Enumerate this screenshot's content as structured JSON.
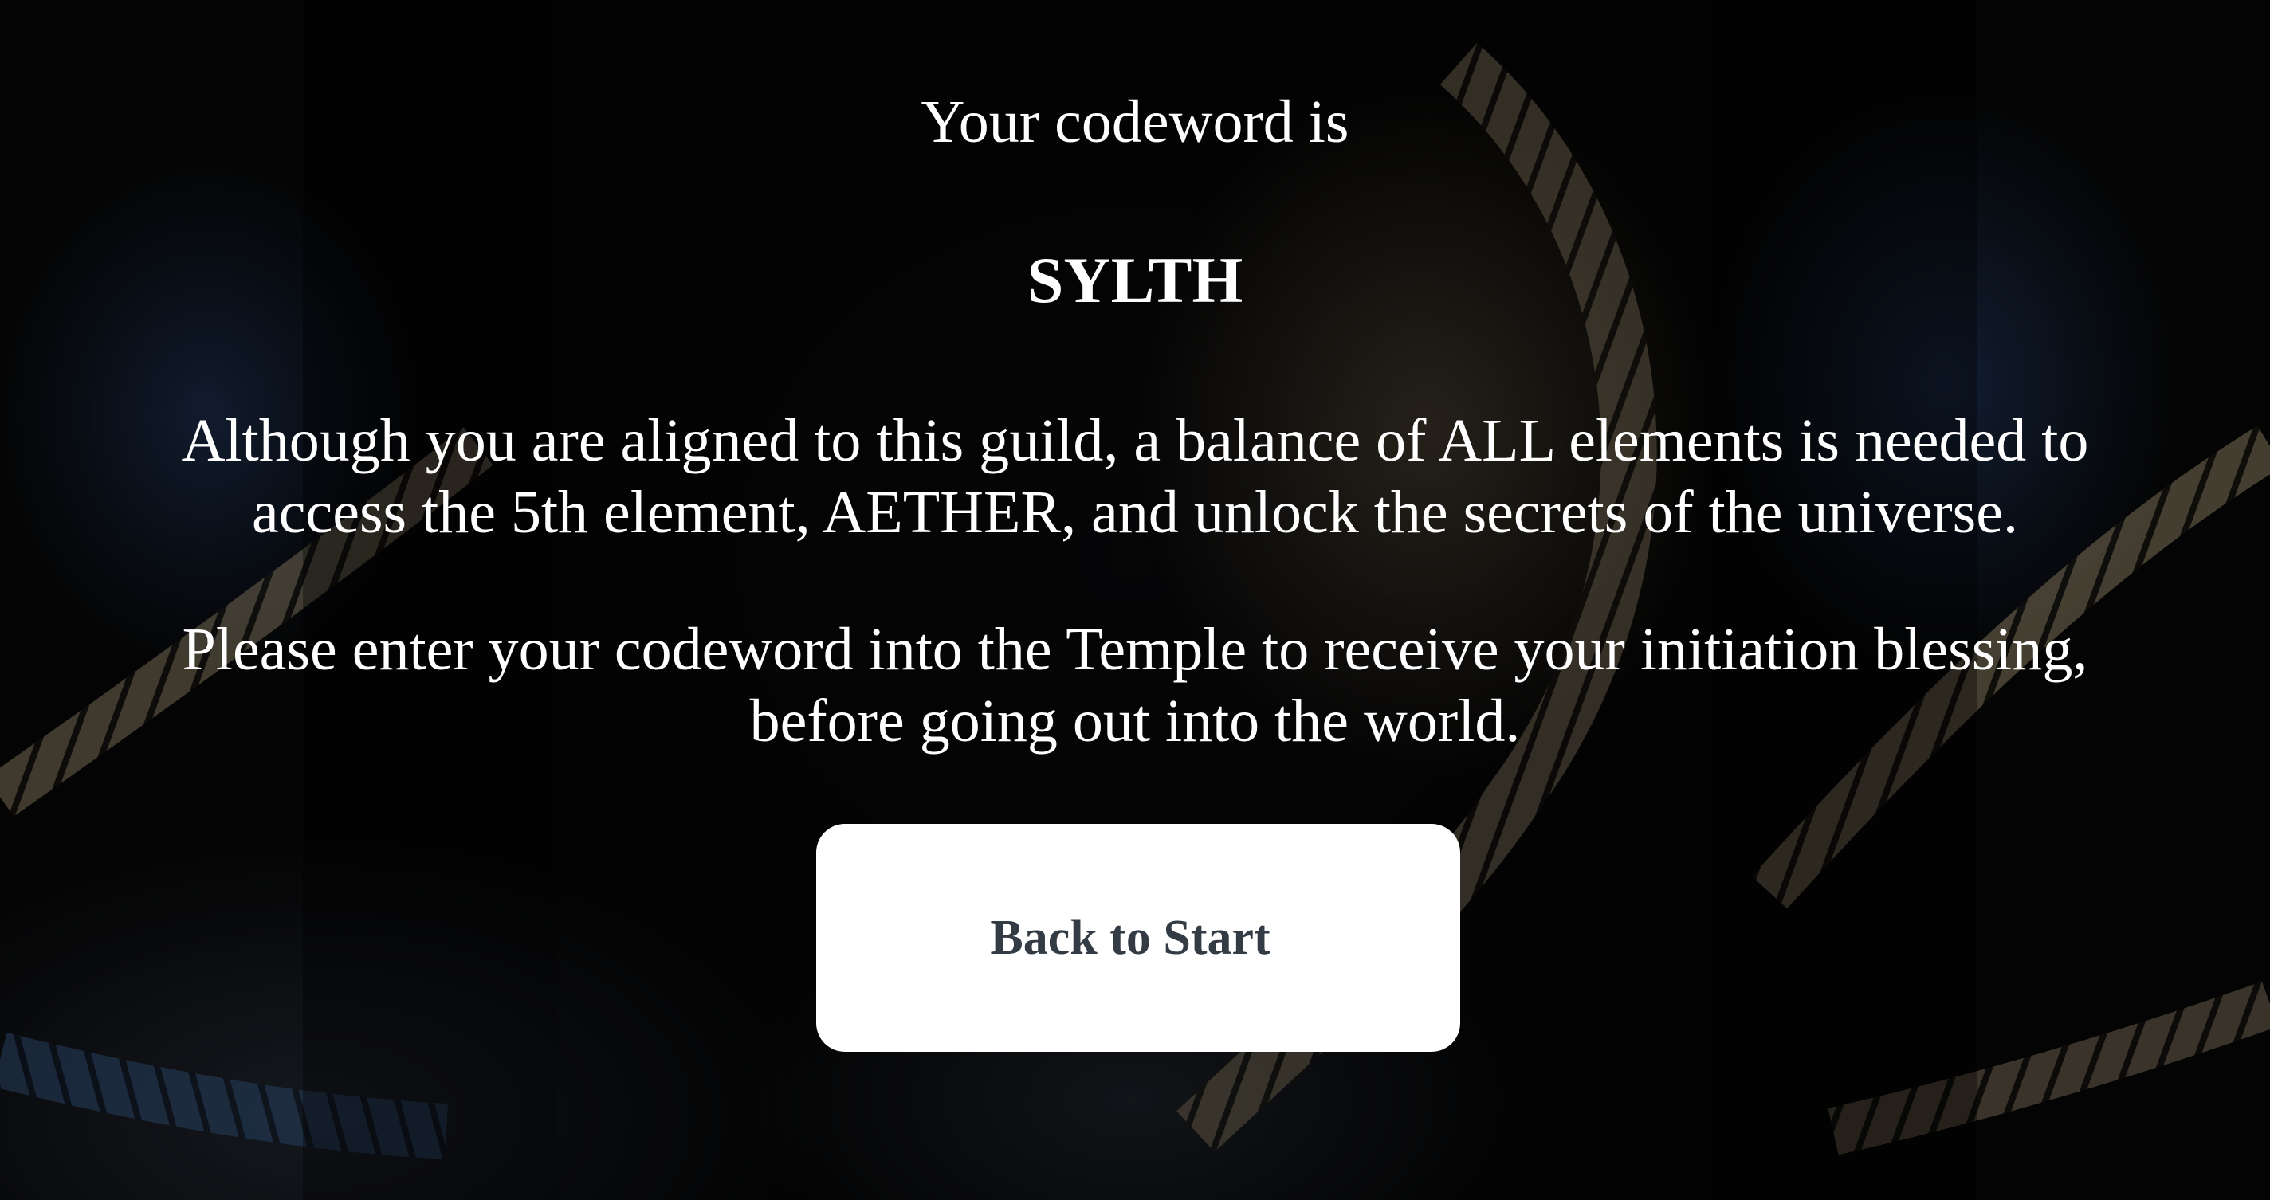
{
  "message": {
    "intro": "Your codeword is",
    "codeword": "SYLTH",
    "paragraph_1": "Although you are aligned to this guild, a balance of ALL elements is needed to access the 5th element, AETHER, and unlock the secrets of the universe.",
    "paragraph_2": "Please enter your codeword into the Temple to receive your initiation blessing, before going out into the world."
  },
  "actions": {
    "back_label": "Back to Start"
  },
  "colors": {
    "background": "#000000",
    "text": "#ffffff",
    "button_bg": "#ffffff",
    "button_text": "#333b45"
  }
}
